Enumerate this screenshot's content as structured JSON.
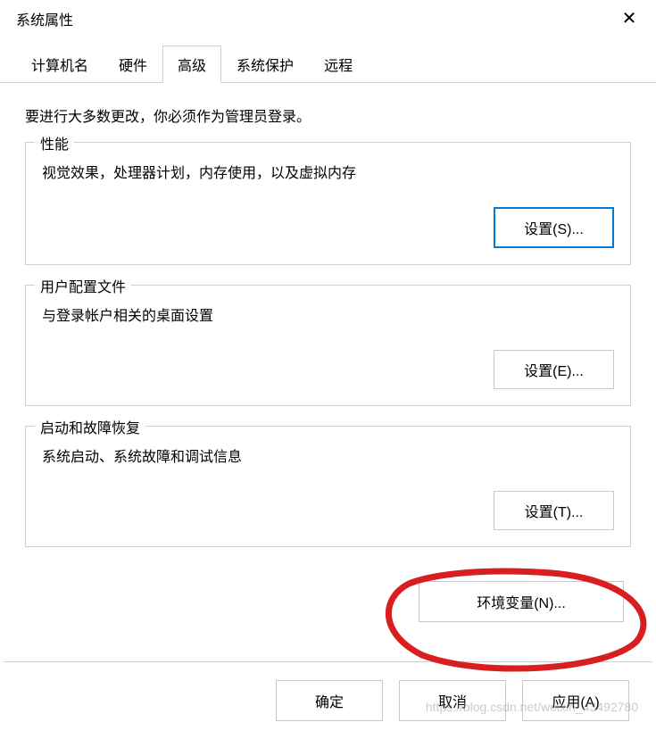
{
  "title": "系统属性",
  "tabs": [
    {
      "label": "计算机名"
    },
    {
      "label": "硬件"
    },
    {
      "label": "高级",
      "active": true
    },
    {
      "label": "系统保护"
    },
    {
      "label": "远程"
    }
  ],
  "note": "要进行大多数更改，你必须作为管理员登录。",
  "groups": {
    "performance": {
      "legend": "性能",
      "desc": "视觉效果，处理器计划，内存使用，以及虚拟内存",
      "button": "设置(S)..."
    },
    "profile": {
      "legend": "用户配置文件",
      "desc": "与登录帐户相关的桌面设置",
      "button": "设置(E)..."
    },
    "startup": {
      "legend": "启动和故障恢复",
      "desc": "系统启动、系统故障和调试信息",
      "button": "设置(T)..."
    }
  },
  "envButton": "环境变量(N)...",
  "bottom": {
    "ok": "确定",
    "cancel": "取消",
    "apply": "应用(A)"
  },
  "watermark": "https://blog.csdn.net/weixin_43492780"
}
